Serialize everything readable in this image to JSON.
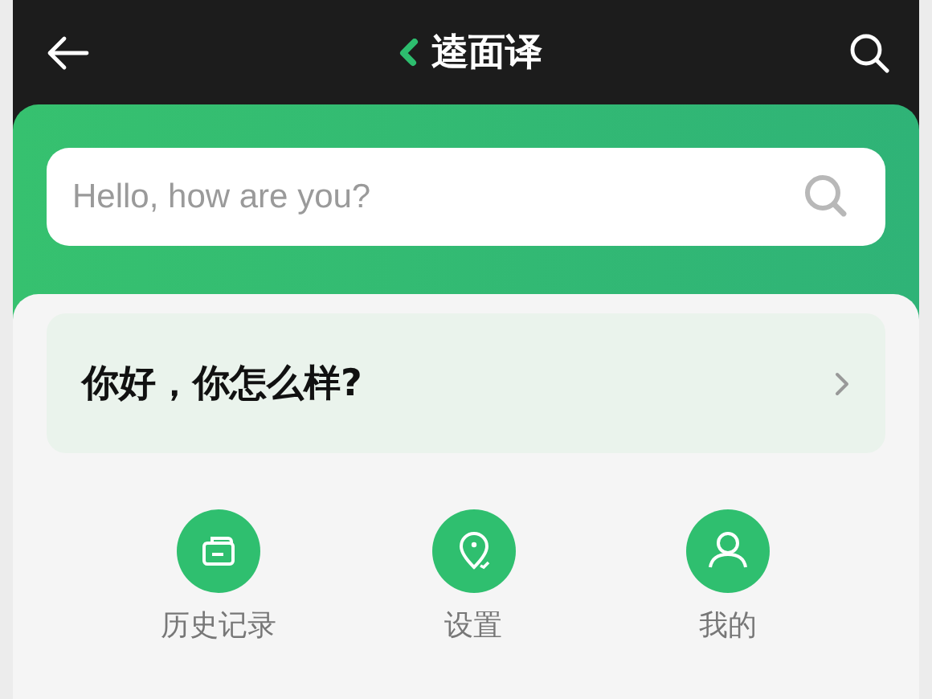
{
  "header": {
    "title": "逵面译"
  },
  "search": {
    "placeholder": "Hello, how are you?"
  },
  "result": {
    "text": "你好，你怎么样?"
  },
  "nav": [
    {
      "label": "历史记录"
    },
    {
      "label": "设置"
    },
    {
      "label": "我的"
    }
  ]
}
